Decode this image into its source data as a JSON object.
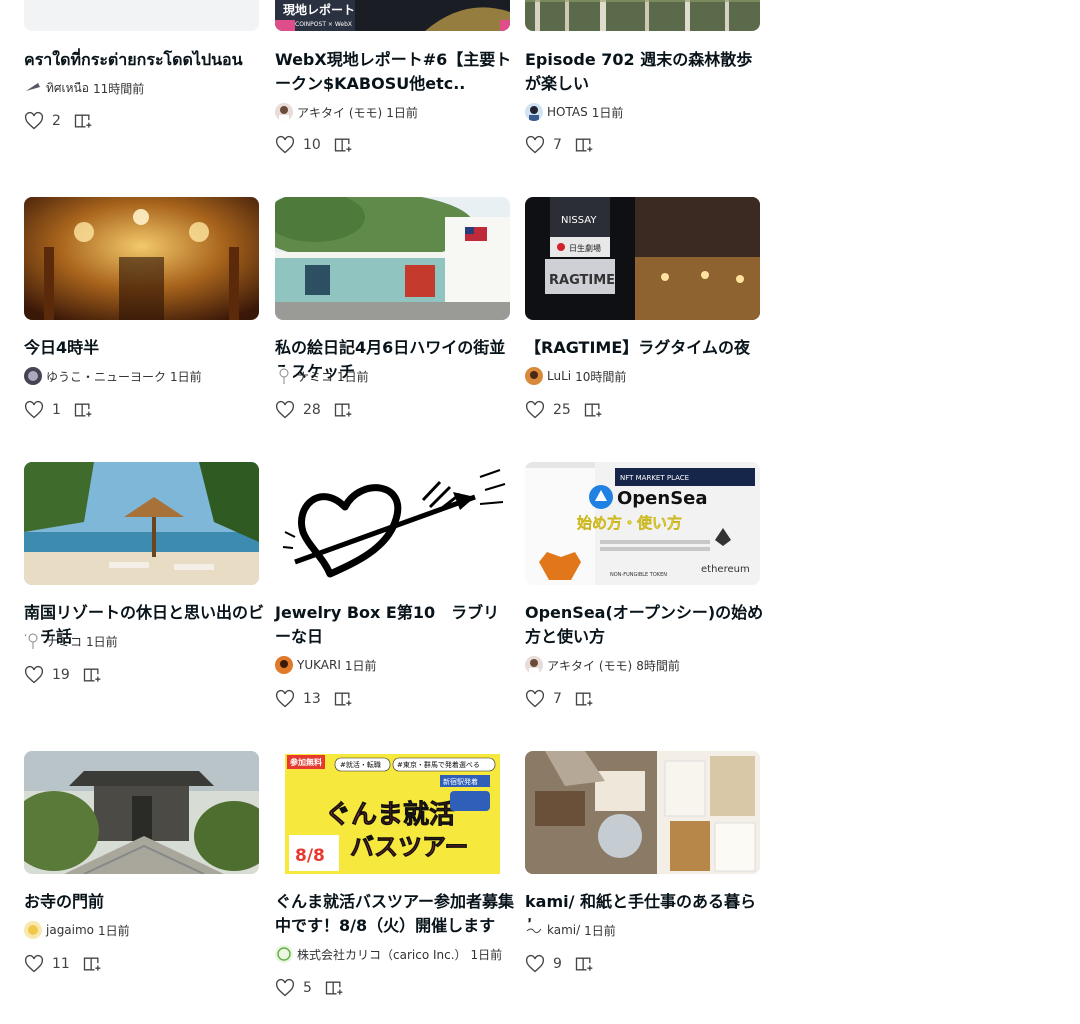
{
  "cards": [
    {
      "title": "คราใดที่กระต่ายกระโดดไปนอน",
      "author": "ทิศเหนือ",
      "time": "11時間前",
      "likes": "2"
    },
    {
      "title": "WebX現地レポート#6【主要トークン$KABOSU他etc..",
      "author": "アキタイ (モモ)",
      "time": "1日前",
      "likes": "10"
    },
    {
      "title": "Episode 702 週末の森林散歩が楽しい",
      "author": "HOTAS",
      "time": "1日前",
      "likes": "7"
    },
    {
      "title": "今日4時半",
      "author": "ゆうこ・ニューヨーク",
      "time": "1日前",
      "likes": "1"
    },
    {
      "title": "私の絵日記4月6日ハワイの街並みスケッチ",
      "author": "ナミコ",
      "time": "1日前",
      "likes": "28"
    },
    {
      "title": "【RAGTIME】ラグタイムの夜",
      "author": "LuLi",
      "time": "10時間前",
      "likes": "25"
    },
    {
      "title": "南国リゾートの休日と思い出のビーチ話",
      "author": "ナミコ",
      "time": "1日前",
      "likes": "19"
    },
    {
      "title": "Jewelry Box E第10　ラブリーな日",
      "author": "YUKARI",
      "time": "1日前",
      "likes": "13"
    },
    {
      "title": "OpenSea(オープンシー)の始め方と使い方",
      "author": "アキタイ (モモ)",
      "time": "8時間前",
      "likes": "7"
    },
    {
      "title": "お寺の門前",
      "author": "jagaimo",
      "time": "1日前",
      "likes": "11"
    },
    {
      "title": "ぐんま就活バスツアー参加者募集中です！8/8（火）開催します",
      "author": "株式会社カリコ（carico Inc.）",
      "time": "1日前",
      "likes": "5"
    },
    {
      "title": "kami/ 和紙と手仕事のある暮らし",
      "author": "kami/",
      "time": "1日前",
      "likes": "9"
    }
  ],
  "thumbs": {
    "webx_banner": "現地レポート",
    "webx_logo": "COINPOST × WebX",
    "nissay": "NISSAY",
    "nissay_jp": "日生劇場",
    "ragtime": "RAGTIME",
    "opensea_top": "NFT MARKET PLACE",
    "opensea_name": "OpenSea",
    "opensea_sub": "始め方・使い方",
    "opensea_eth": "ethereum",
    "opensea_nft": "NON-FUNGIBLE TOKEN",
    "gunma_tags1": "#就活・転職",
    "gunma_tags2": "#東京・群馬で発着選べる",
    "gunma_main1": "ぐんま就活",
    "gunma_main2": "バスツアー",
    "gunma_date": "8/8",
    "gunma_badge": "参加無料",
    "gunma_dept": "新宿駅発着"
  },
  "icons": {
    "like": "heart-icon",
    "save": "add-to-magazine-icon"
  },
  "colors": {
    "text": "#08131a",
    "gunma_yellow": "#f6e83c",
    "opensea_blue": "#2081e2"
  }
}
